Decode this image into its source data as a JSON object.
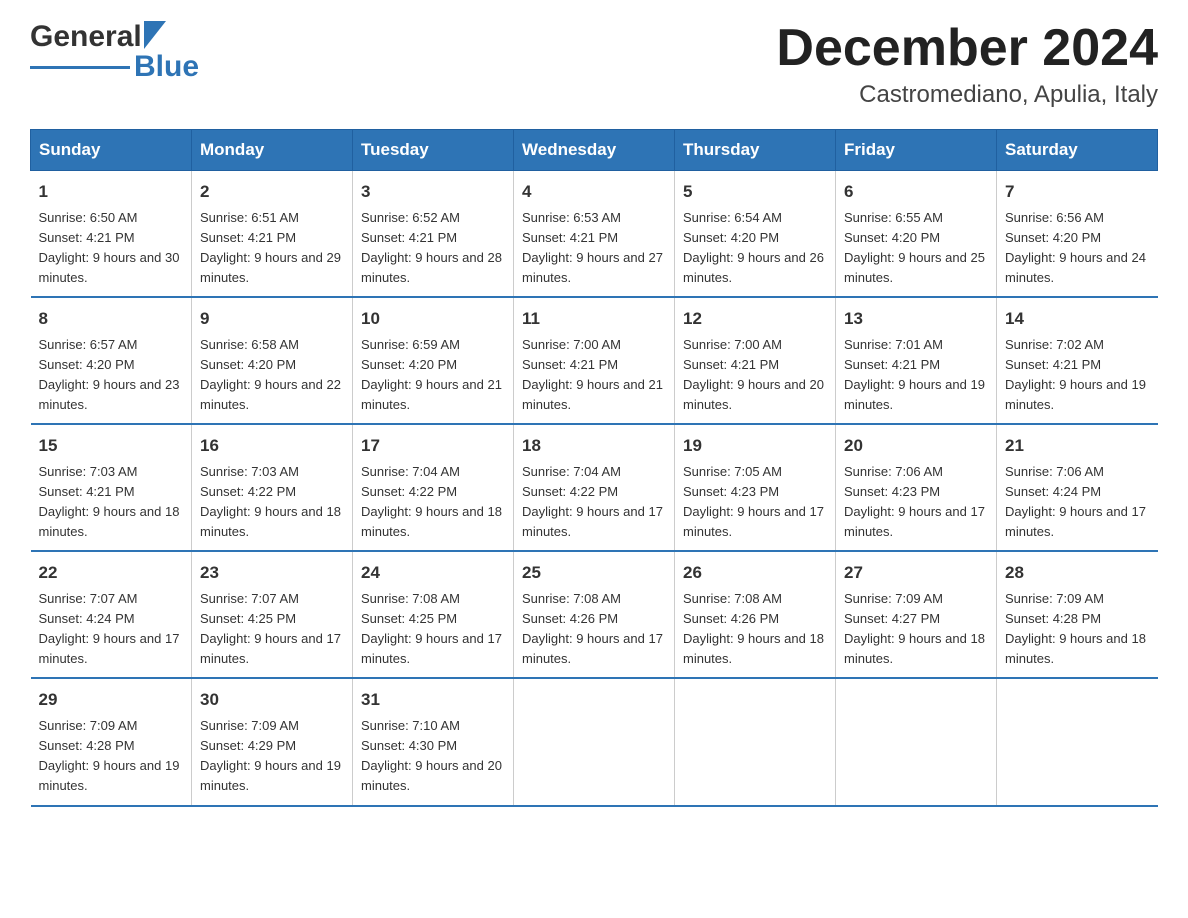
{
  "logo": {
    "text_general": "General",
    "text_blue": "Blue"
  },
  "title": "December 2024",
  "subtitle": "Castromediano, Apulia, Italy",
  "days_header": [
    "Sunday",
    "Monday",
    "Tuesday",
    "Wednesday",
    "Thursday",
    "Friday",
    "Saturday"
  ],
  "weeks": [
    [
      {
        "num": "1",
        "sunrise": "6:50 AM",
        "sunset": "4:21 PM",
        "daylight": "9 hours and 30 minutes."
      },
      {
        "num": "2",
        "sunrise": "6:51 AM",
        "sunset": "4:21 PM",
        "daylight": "9 hours and 29 minutes."
      },
      {
        "num": "3",
        "sunrise": "6:52 AM",
        "sunset": "4:21 PM",
        "daylight": "9 hours and 28 minutes."
      },
      {
        "num": "4",
        "sunrise": "6:53 AM",
        "sunset": "4:21 PM",
        "daylight": "9 hours and 27 minutes."
      },
      {
        "num": "5",
        "sunrise": "6:54 AM",
        "sunset": "4:20 PM",
        "daylight": "9 hours and 26 minutes."
      },
      {
        "num": "6",
        "sunrise": "6:55 AM",
        "sunset": "4:20 PM",
        "daylight": "9 hours and 25 minutes."
      },
      {
        "num": "7",
        "sunrise": "6:56 AM",
        "sunset": "4:20 PM",
        "daylight": "9 hours and 24 minutes."
      }
    ],
    [
      {
        "num": "8",
        "sunrise": "6:57 AM",
        "sunset": "4:20 PM",
        "daylight": "9 hours and 23 minutes."
      },
      {
        "num": "9",
        "sunrise": "6:58 AM",
        "sunset": "4:20 PM",
        "daylight": "9 hours and 22 minutes."
      },
      {
        "num": "10",
        "sunrise": "6:59 AM",
        "sunset": "4:20 PM",
        "daylight": "9 hours and 21 minutes."
      },
      {
        "num": "11",
        "sunrise": "7:00 AM",
        "sunset": "4:21 PM",
        "daylight": "9 hours and 21 minutes."
      },
      {
        "num": "12",
        "sunrise": "7:00 AM",
        "sunset": "4:21 PM",
        "daylight": "9 hours and 20 minutes."
      },
      {
        "num": "13",
        "sunrise": "7:01 AM",
        "sunset": "4:21 PM",
        "daylight": "9 hours and 19 minutes."
      },
      {
        "num": "14",
        "sunrise": "7:02 AM",
        "sunset": "4:21 PM",
        "daylight": "9 hours and 19 minutes."
      }
    ],
    [
      {
        "num": "15",
        "sunrise": "7:03 AM",
        "sunset": "4:21 PM",
        "daylight": "9 hours and 18 minutes."
      },
      {
        "num": "16",
        "sunrise": "7:03 AM",
        "sunset": "4:22 PM",
        "daylight": "9 hours and 18 minutes."
      },
      {
        "num": "17",
        "sunrise": "7:04 AM",
        "sunset": "4:22 PM",
        "daylight": "9 hours and 18 minutes."
      },
      {
        "num": "18",
        "sunrise": "7:04 AM",
        "sunset": "4:22 PM",
        "daylight": "9 hours and 17 minutes."
      },
      {
        "num": "19",
        "sunrise": "7:05 AM",
        "sunset": "4:23 PM",
        "daylight": "9 hours and 17 minutes."
      },
      {
        "num": "20",
        "sunrise": "7:06 AM",
        "sunset": "4:23 PM",
        "daylight": "9 hours and 17 minutes."
      },
      {
        "num": "21",
        "sunrise": "7:06 AM",
        "sunset": "4:24 PM",
        "daylight": "9 hours and 17 minutes."
      }
    ],
    [
      {
        "num": "22",
        "sunrise": "7:07 AM",
        "sunset": "4:24 PM",
        "daylight": "9 hours and 17 minutes."
      },
      {
        "num": "23",
        "sunrise": "7:07 AM",
        "sunset": "4:25 PM",
        "daylight": "9 hours and 17 minutes."
      },
      {
        "num": "24",
        "sunrise": "7:08 AM",
        "sunset": "4:25 PM",
        "daylight": "9 hours and 17 minutes."
      },
      {
        "num": "25",
        "sunrise": "7:08 AM",
        "sunset": "4:26 PM",
        "daylight": "9 hours and 17 minutes."
      },
      {
        "num": "26",
        "sunrise": "7:08 AM",
        "sunset": "4:26 PM",
        "daylight": "9 hours and 18 minutes."
      },
      {
        "num": "27",
        "sunrise": "7:09 AM",
        "sunset": "4:27 PM",
        "daylight": "9 hours and 18 minutes."
      },
      {
        "num": "28",
        "sunrise": "7:09 AM",
        "sunset": "4:28 PM",
        "daylight": "9 hours and 18 minutes."
      }
    ],
    [
      {
        "num": "29",
        "sunrise": "7:09 AM",
        "sunset": "4:28 PM",
        "daylight": "9 hours and 19 minutes."
      },
      {
        "num": "30",
        "sunrise": "7:09 AM",
        "sunset": "4:29 PM",
        "daylight": "9 hours and 19 minutes."
      },
      {
        "num": "31",
        "sunrise": "7:10 AM",
        "sunset": "4:30 PM",
        "daylight": "9 hours and 20 minutes."
      },
      null,
      null,
      null,
      null
    ]
  ],
  "cell_labels": {
    "sunrise": "Sunrise: ",
    "sunset": "Sunset: ",
    "daylight": "Daylight: "
  }
}
